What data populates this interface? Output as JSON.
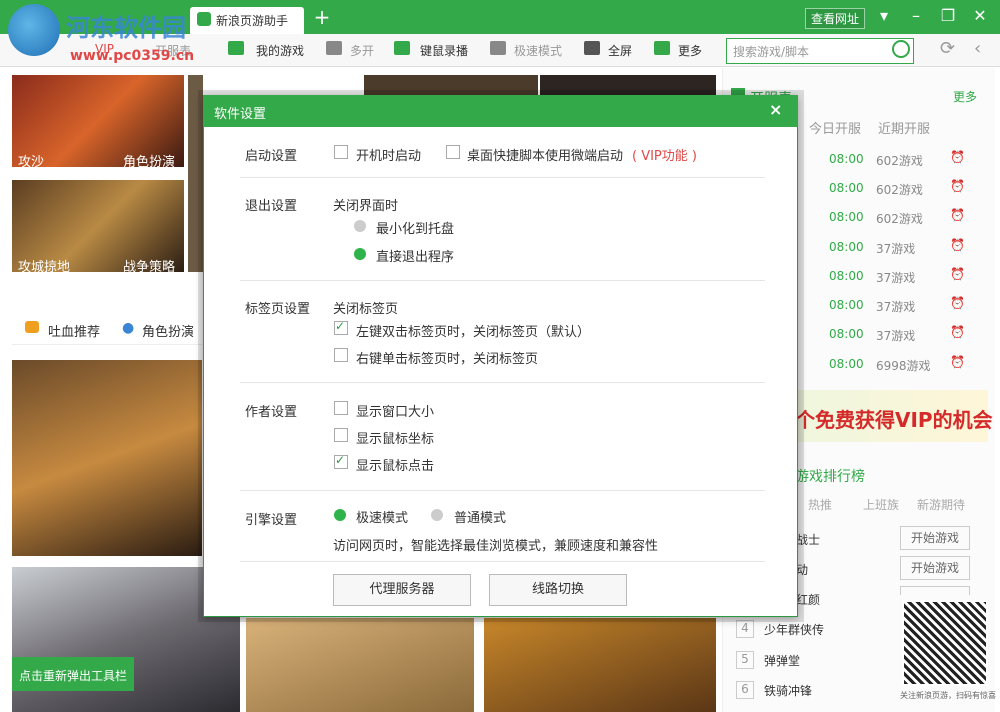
{
  "app": {
    "watermark": "河东软件园",
    "watermark_url": "www.pc0359.cn",
    "tab_label": "新浪页游助手",
    "view_site": "查看网址"
  },
  "toolbar": {
    "vip": "VIP",
    "kaifu": "开服表",
    "my_games": "我的游戏",
    "multi": "多开",
    "keyrec": "键鼠录播",
    "speed": "极速模式",
    "fullscreen": "全屏",
    "more": "更多",
    "search_placeholder": "搜索游戏/脚本"
  },
  "left_tiles": [
    {
      "title": "攻沙",
      "tag": "角色扮演"
    },
    {
      "title": "攻城掠地",
      "tag": "战争策略"
    }
  ],
  "rec_tabs": {
    "a": "吐血推荐",
    "b": "角色扮演"
  },
  "toolbar_popup": "点击重新弹出工具栏",
  "sidebar": {
    "header": "开服表",
    "more": "更多",
    "tab_today": "今日开服",
    "tab_upcoming": "近期开服",
    "servers": [
      {
        "time": "08:00",
        "name": "602游戏"
      },
      {
        "time": "08:00",
        "name": "602游戏"
      },
      {
        "time": "08:00",
        "name": "602游戏"
      },
      {
        "time": "08:00",
        "name": "37游戏"
      },
      {
        "time": "08:00",
        "name": "37游戏"
      },
      {
        "time": "08:00",
        "name": "37游戏"
      },
      {
        "time": "08:00",
        "name": "37游戏"
      },
      {
        "time": "08:00",
        "name": "6998游戏"
      }
    ],
    "banner": "个免费获得VIP的机会",
    "rank_title": "游戏排行榜",
    "rank_tabs": [
      "热推",
      "上班族",
      "新游期待"
    ],
    "rank_items": [
      {
        "num": "",
        "name": "战士",
        "btn": "开始游戏"
      },
      {
        "num": "",
        "name": "动",
        "btn": "开始游戏"
      },
      {
        "num": "",
        "name": "红颜",
        "btn": "开始游戏"
      },
      {
        "num": "4",
        "name": "少年群侠传",
        "btn": ""
      },
      {
        "num": "5",
        "name": "弹弹堂",
        "btn": ""
      },
      {
        "num": "6",
        "name": "铁骑冲锋",
        "btn": ""
      }
    ],
    "qr_caption": "关注新浪页游，扫码有惊喜"
  },
  "dialog": {
    "title": "软件设置",
    "close": "×",
    "startup": {
      "label": "启动设置",
      "opt1": "开机时启动",
      "opt2": "桌面快捷脚本使用微端启动",
      "vip": "( VIP功能 )"
    },
    "exit": {
      "label": "退出设置",
      "sub": "关闭界面时",
      "opt1": "最小化到托盘",
      "opt2": "直接退出程序"
    },
    "tabs": {
      "label": "标签页设置",
      "sub": "关闭标签页",
      "opt1": "左键双击标签页时，关闭标签页（默认）",
      "opt2": "右键单击标签页时，关闭标签页"
    },
    "author": {
      "label": "作者设置",
      "opt1": "显示窗口大小",
      "opt2": "显示鼠标坐标",
      "opt3": "显示鼠标点击"
    },
    "engine": {
      "label": "引擎设置",
      "opt1": "极速模式",
      "opt2": "普通模式",
      "desc": "访问网页时，智能选择最佳浏览模式，兼顾速度和兼容性"
    },
    "btn_proxy": "代理服务器",
    "btn_line": "线路切换"
  },
  "colors": {
    "accent": "#33a949",
    "vip_red": "#e04848"
  }
}
